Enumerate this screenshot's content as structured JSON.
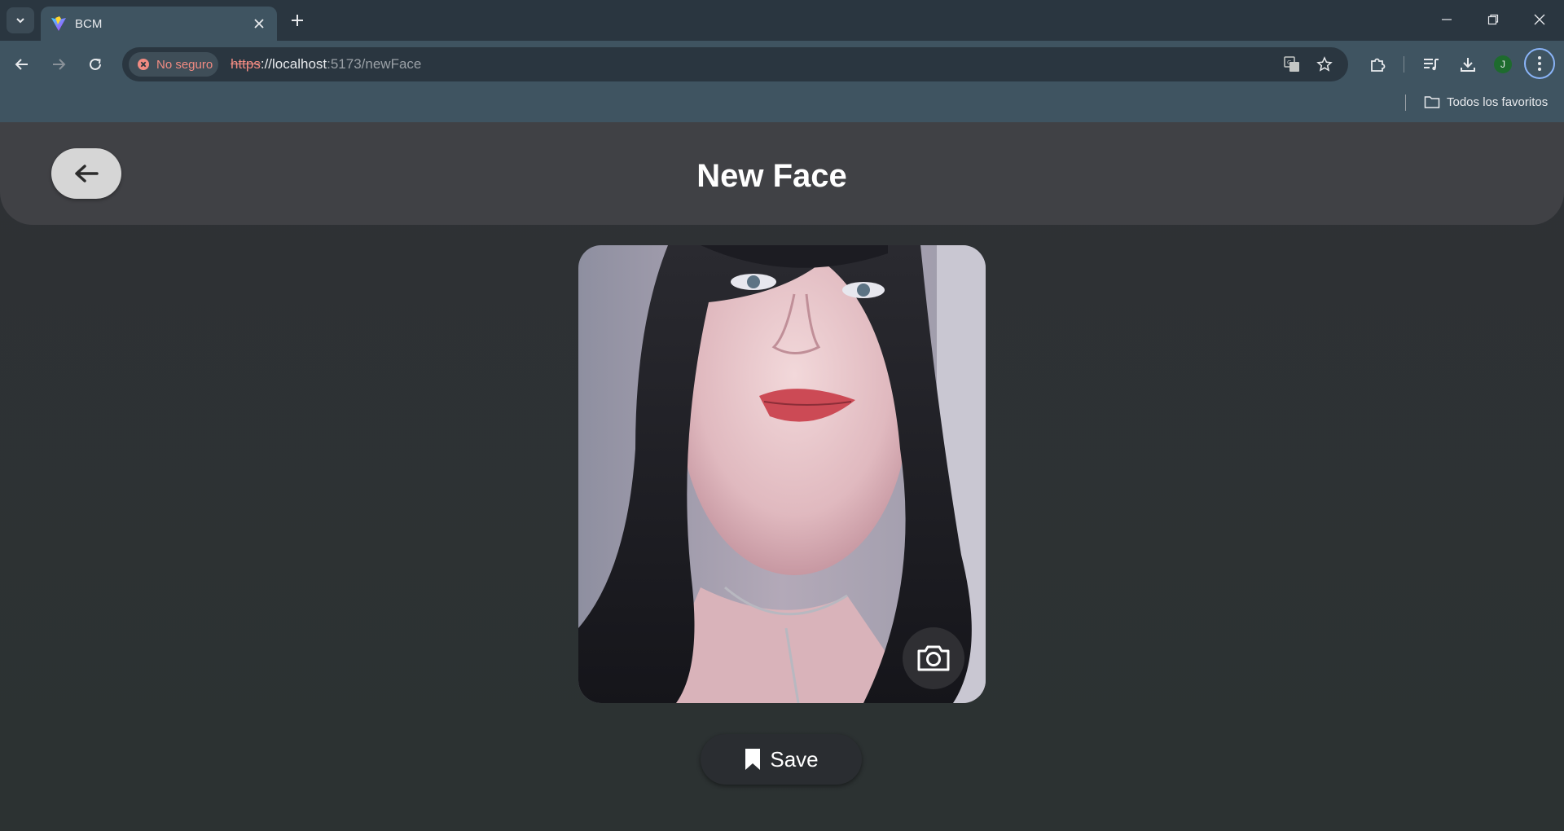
{
  "browser": {
    "tab": {
      "title": "BCM",
      "favicon": "vite-logo-icon"
    },
    "address": {
      "security_label": "No seguro",
      "url_scheme": "https",
      "url_host": "://localhost",
      "url_rest": ":5173/newFace"
    },
    "profile_initial": "J",
    "bookmarks": {
      "folder_label": "Todos los favoritos"
    },
    "accent_color": "#8ab4f8",
    "warning_color": "#f28b82"
  },
  "page": {
    "title": "New Face",
    "back_button_icon": "arrow-left-icon",
    "photo": {
      "description_icon": "face-photo",
      "camera_icon": "camera-icon"
    },
    "save_button": {
      "label": "Save",
      "icon": "bookmark-icon"
    }
  }
}
